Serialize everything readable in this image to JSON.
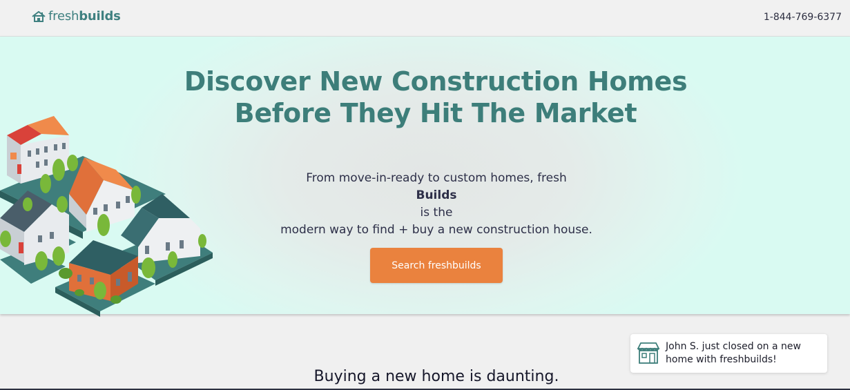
{
  "header": {
    "logo": {
      "prefix": "fresh",
      "suffix": "builds",
      "icon": "house-icon"
    },
    "phone": "1-844-769-6377"
  },
  "hero": {
    "title_lines": [
      "Discover New Construction Homes",
      "Before They Hit The Market"
    ],
    "subtitle": {
      "line1_before": "From move-in-ready to custom homes, fresh",
      "line1_bold": "Builds",
      "line1_after": " is the",
      "line2": "modern way to find + buy a new construction house."
    },
    "cta_label": "Search freshbuilds",
    "illustration": "isometric-neighborhood-illustration"
  },
  "section": {
    "title": "Buying a new home is daunting."
  },
  "toast": {
    "icon": "storefront-icon",
    "line1": "John S. just closed on a new",
    "line2": "home with freshbuilds!"
  },
  "colors": {
    "brand_teal": "#3d7e7a",
    "cta_orange": "#ea823e",
    "hero_bg": "#d9faf2",
    "text_dark": "#2d2f48"
  }
}
